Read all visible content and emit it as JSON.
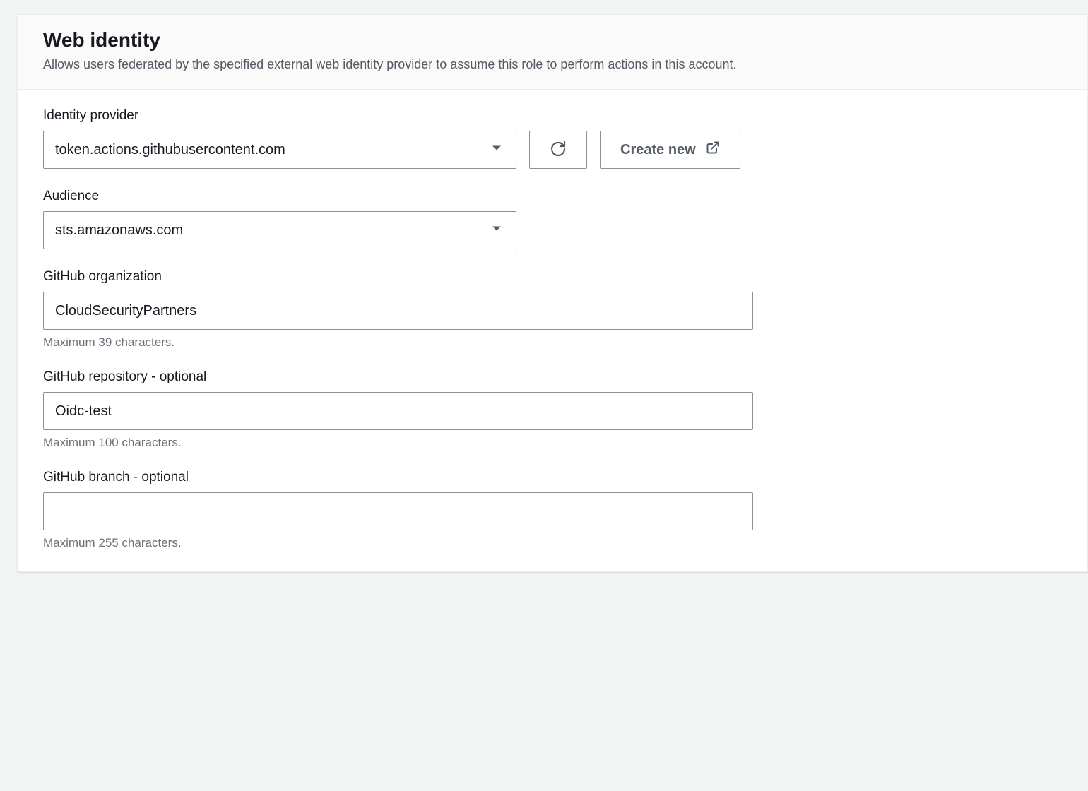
{
  "header": {
    "title": "Web identity",
    "description": "Allows users federated by the specified external web identity provider to assume this role to perform actions in this account."
  },
  "identityProvider": {
    "label": "Identity provider",
    "value": "token.actions.githubusercontent.com",
    "createNewLabel": "Create new"
  },
  "audience": {
    "label": "Audience",
    "value": "sts.amazonaws.com"
  },
  "githubOrganization": {
    "label": "GitHub organization",
    "value": "CloudSecurityPartners",
    "helper": "Maximum 39 characters."
  },
  "githubRepository": {
    "label": "GitHub repository - optional",
    "value": "Oidc-test",
    "helper": "Maximum 100 characters."
  },
  "githubBranch": {
    "label": "GitHub branch - optional",
    "value": "",
    "helper": "Maximum 255 characters."
  }
}
